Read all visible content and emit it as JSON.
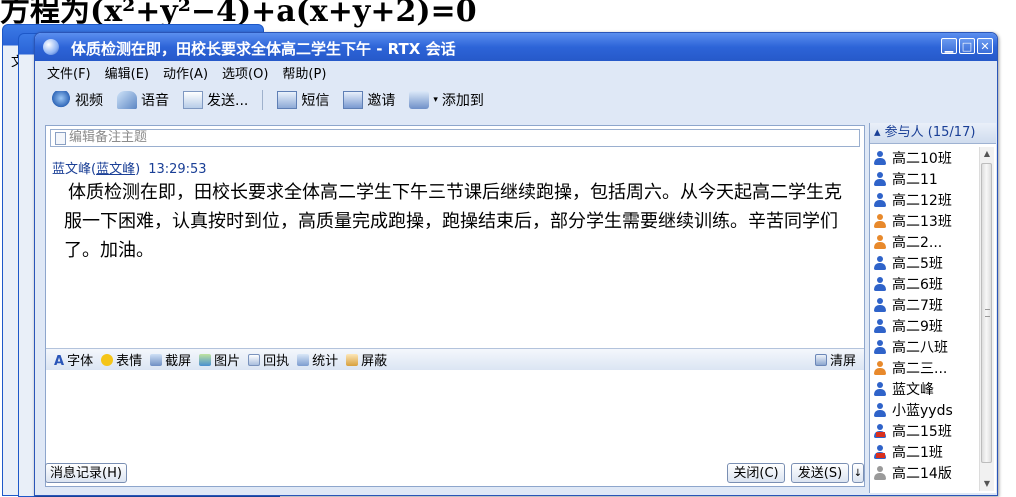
{
  "background": {
    "heading": "方程为(x²+y²−4)+a(x+y+2)=0"
  },
  "back_windows": {
    "menu_fragment": "文"
  },
  "window": {
    "title": "体质检测在即，田校长要求全体高二学生下午 - RTX 会话",
    "controls": {
      "minimize": "▁",
      "maximize": "□",
      "close": "✕"
    }
  },
  "menu": [
    "文件(F)",
    "编辑(E)",
    "动作(A)",
    "选项(O)",
    "帮助(P)"
  ],
  "toolbar": {
    "video": "视频",
    "voice": "语音",
    "send": "发送...",
    "sms": "短信",
    "invite": "邀请",
    "add_to": "添加到"
  },
  "subject": {
    "placeholder": "编辑备注主题"
  },
  "message": {
    "sender": "蓝文峰",
    "sender_link": "蓝文峰",
    "time": "13:29:53",
    "text": "体质检测在即，田校长要求全体高二学生下午三节课后继续跑操，包括周六。从今天起高二学生克服一下困难，认真按时到位，高质量完成跑操，跑操结束后，部分学生需要继续训练。辛苦同学们了。加油。"
  },
  "format_bar": {
    "font": "字体",
    "emoji": "表情",
    "screenshot": "截屏",
    "picture": "图片",
    "receipt": "回执",
    "stats": "统计",
    "block": "屏蔽",
    "clear": "清屏"
  },
  "buttons": {
    "history": "消息记录(H)",
    "close": "关闭(C)",
    "send": "发送(S)"
  },
  "participants": {
    "header": "参与人 (15/17)",
    "items": [
      {
        "name": "高二10班",
        "status": "blue"
      },
      {
        "name": "高二11",
        "status": "blue"
      },
      {
        "name": "高二12班",
        "status": "blue"
      },
      {
        "name": "高二13班",
        "status": "orange"
      },
      {
        "name": "高二2...",
        "status": "orange"
      },
      {
        "name": "高二5班",
        "status": "blue"
      },
      {
        "name": "高二6班",
        "status": "blue"
      },
      {
        "name": "高二7班",
        "status": "blue"
      },
      {
        "name": "高二9班",
        "status": "blue"
      },
      {
        "name": "高二八班",
        "status": "blue"
      },
      {
        "name": "高二三...",
        "status": "orange"
      },
      {
        "name": "蓝文峰",
        "status": "blue"
      },
      {
        "name": "小蓝yyds",
        "status": "blue"
      },
      {
        "name": "高二15班",
        "status": "mobile"
      },
      {
        "name": "高二1班",
        "status": "mobile"
      },
      {
        "name": "高二14版",
        "status": "gray"
      }
    ]
  }
}
